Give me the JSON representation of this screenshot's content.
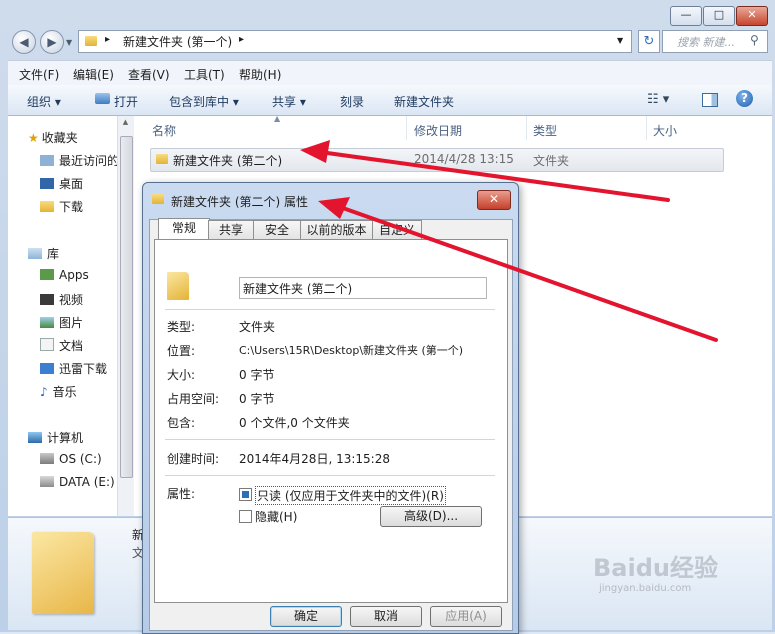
{
  "window": {
    "caption_buttons": {
      "minimize": "—",
      "maximize": "□",
      "close": "✕"
    },
    "address": {
      "arrow": "▸",
      "path": "新建文件夹 (第一个)",
      "arrow2": "▸"
    },
    "search_placeholder": "搜索 新建..."
  },
  "menu": [
    "文件(F)",
    "编辑(E)",
    "查看(V)",
    "工具(T)",
    "帮助(H)"
  ],
  "toolbar": {
    "organize": "组织 ▾",
    "open": "打开",
    "include_library": "包含到库中 ▾",
    "share": "共享 ▾",
    "burn": "刻录",
    "new_folder": "新建文件夹"
  },
  "sidebar": {
    "favorites": "收藏夹",
    "recent": "最近访问的",
    "desktop": "桌面",
    "downloads": "下载",
    "libraries": "库",
    "apps": "Apps",
    "video": "视频",
    "pictures": "图片",
    "documents": "文档",
    "thunder": "迅雷下载",
    "music": "音乐",
    "computer": "计算机",
    "os_c": "OS (C:)",
    "data_e": "DATA (E:)"
  },
  "columns": {
    "name": "名称",
    "modified": "修改日期",
    "type": "类型",
    "size": "大小"
  },
  "files": [
    {
      "name": "新建文件夹 (第二个)",
      "modified": "2014/4/28 13:15",
      "type": "文件夹"
    }
  ],
  "details": {
    "name_partial": "新",
    "type_partial": "文"
  },
  "dialog": {
    "title": "新建文件夹 (第二个) 属性",
    "tabs": [
      "常规",
      "共享",
      "安全",
      "以前的版本",
      "自定义"
    ],
    "folder_name": "新建文件夹 (第二个)",
    "labels": {
      "type": "类型:",
      "location": "位置:",
      "size": "大小:",
      "size_on_disk": "占用空间:",
      "contains": "包含:",
      "created": "创建时间:",
      "attributes": "属性:"
    },
    "values": {
      "type": "文件夹",
      "location": "C:\\Users\\15R\\Desktop\\新建文件夹 (第一个)",
      "size": "0 字节",
      "size_on_disk": "0 字节",
      "contains": "0 个文件,0 个文件夹",
      "created": "2014年4月28日, 13:15:28"
    },
    "readonly_label": "只读 (仅应用于文件夹中的文件)(R)",
    "hidden_label": "隐藏(H)",
    "advanced_label": "高级(D)...",
    "ok": "确定",
    "cancel": "取消",
    "apply": "应用(A)"
  },
  "watermark": {
    "brand": "Baidu经验",
    "url": "jingyan.baidu.com"
  },
  "annotation_color": "#e3142d"
}
